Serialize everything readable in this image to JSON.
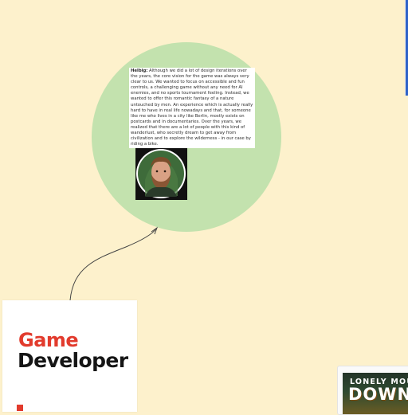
{
  "quote": {
    "speaker": "Helbig:",
    "text": " Although we did a lot of design iterations over the years, the core vision for the game was always very clear to us. We  wanted to focus on accessible and fun controls, a challenging  game without any need for AI enemies, and no sports tournament feeling.  Instead, we wanted to offer this romantic fantasy of a nature untouched  by men. An experience which is actually really hard to have in real life  nowadays and that, for someone like me who lives in a city like Berlin, mostly exists on postcards and in documentaries. Over the years, we  realized that there are a lot of people with this kind of wanderlust,  who secretly dream to get away from civilization and to explore the  wilderness - in our case by riding a bike."
  },
  "card": {
    "logo_line1": "Game",
    "logo_line2": "Developer"
  },
  "game": {
    "title_line1": "LONELY MOUNT",
    "title_line2": "DOWNH"
  },
  "colors": {
    "canvas": "#fdf1cc",
    "bubble": "#c3e2ae",
    "logo_red": "#e23b2d",
    "logo_black": "#151515",
    "edge_bar": "#2f63c8"
  },
  "icons": {
    "portrait": "bearded-man-portrait",
    "connector": "curved-arrow"
  }
}
